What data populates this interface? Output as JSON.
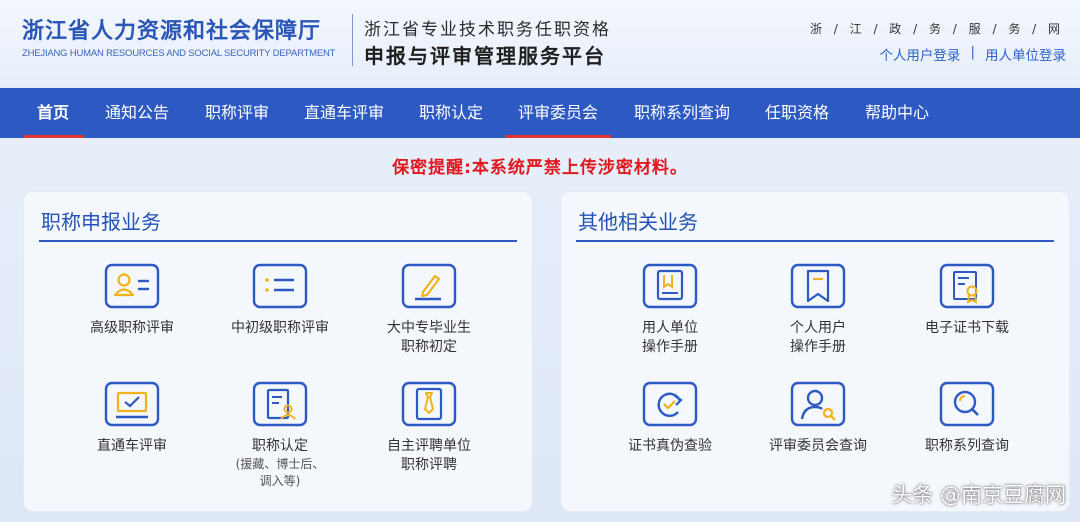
{
  "header": {
    "dept_cn": "浙江省人力资源和社会保障厅",
    "dept_en": "ZHEJIANG HUMAN RESOURCES AND SOCIAL SECURITY DEPARTMENT",
    "platform_line1": "浙江省专业技术职务任职资格",
    "platform_line2": "申报与评审管理服务平台",
    "zwfw": "浙 / 江 / 政 / 务 / 服 / 务 / 网",
    "login_personal": "个人用户登录",
    "login_sep": "|",
    "login_unit": "用人单位登录"
  },
  "nav": {
    "items": [
      "首页",
      "通知公告",
      "职称评审",
      "直通车评审",
      "职称认定",
      "评审委员会",
      "职称系列查询",
      "任职资格",
      "帮助中心"
    ]
  },
  "warning": "保密提醒:本系统严禁上传涉密材料。",
  "left_panel": {
    "title": "职称申报业务",
    "tiles": [
      {
        "label": "高级职称评审"
      },
      {
        "label": "中初级职称评审"
      },
      {
        "label": "大中专毕业生",
        "label2": "职称初定"
      },
      {
        "label": "直通车评审"
      },
      {
        "label": "职称认定",
        "sub1": "(援藏、博士后、",
        "sub2": "调入等)"
      },
      {
        "label": "自主评聘单位",
        "label2": "职称评聘"
      }
    ]
  },
  "right_panel": {
    "title": "其他相关业务",
    "tiles": [
      {
        "label": "用人单位",
        "label2": "操作手册"
      },
      {
        "label": "个人用户",
        "label2": "操作手册"
      },
      {
        "label": "电子证书下载"
      },
      {
        "label": "证书真伪查验"
      },
      {
        "label": "评审委员会查询"
      },
      {
        "label": "职称系列查询"
      }
    ]
  },
  "watermark": "头条 @南京豆腐网",
  "colors": {
    "brand_blue": "#2d59c2",
    "warning_red": "#e0191f",
    "icon_gold": "#f2b21c"
  }
}
